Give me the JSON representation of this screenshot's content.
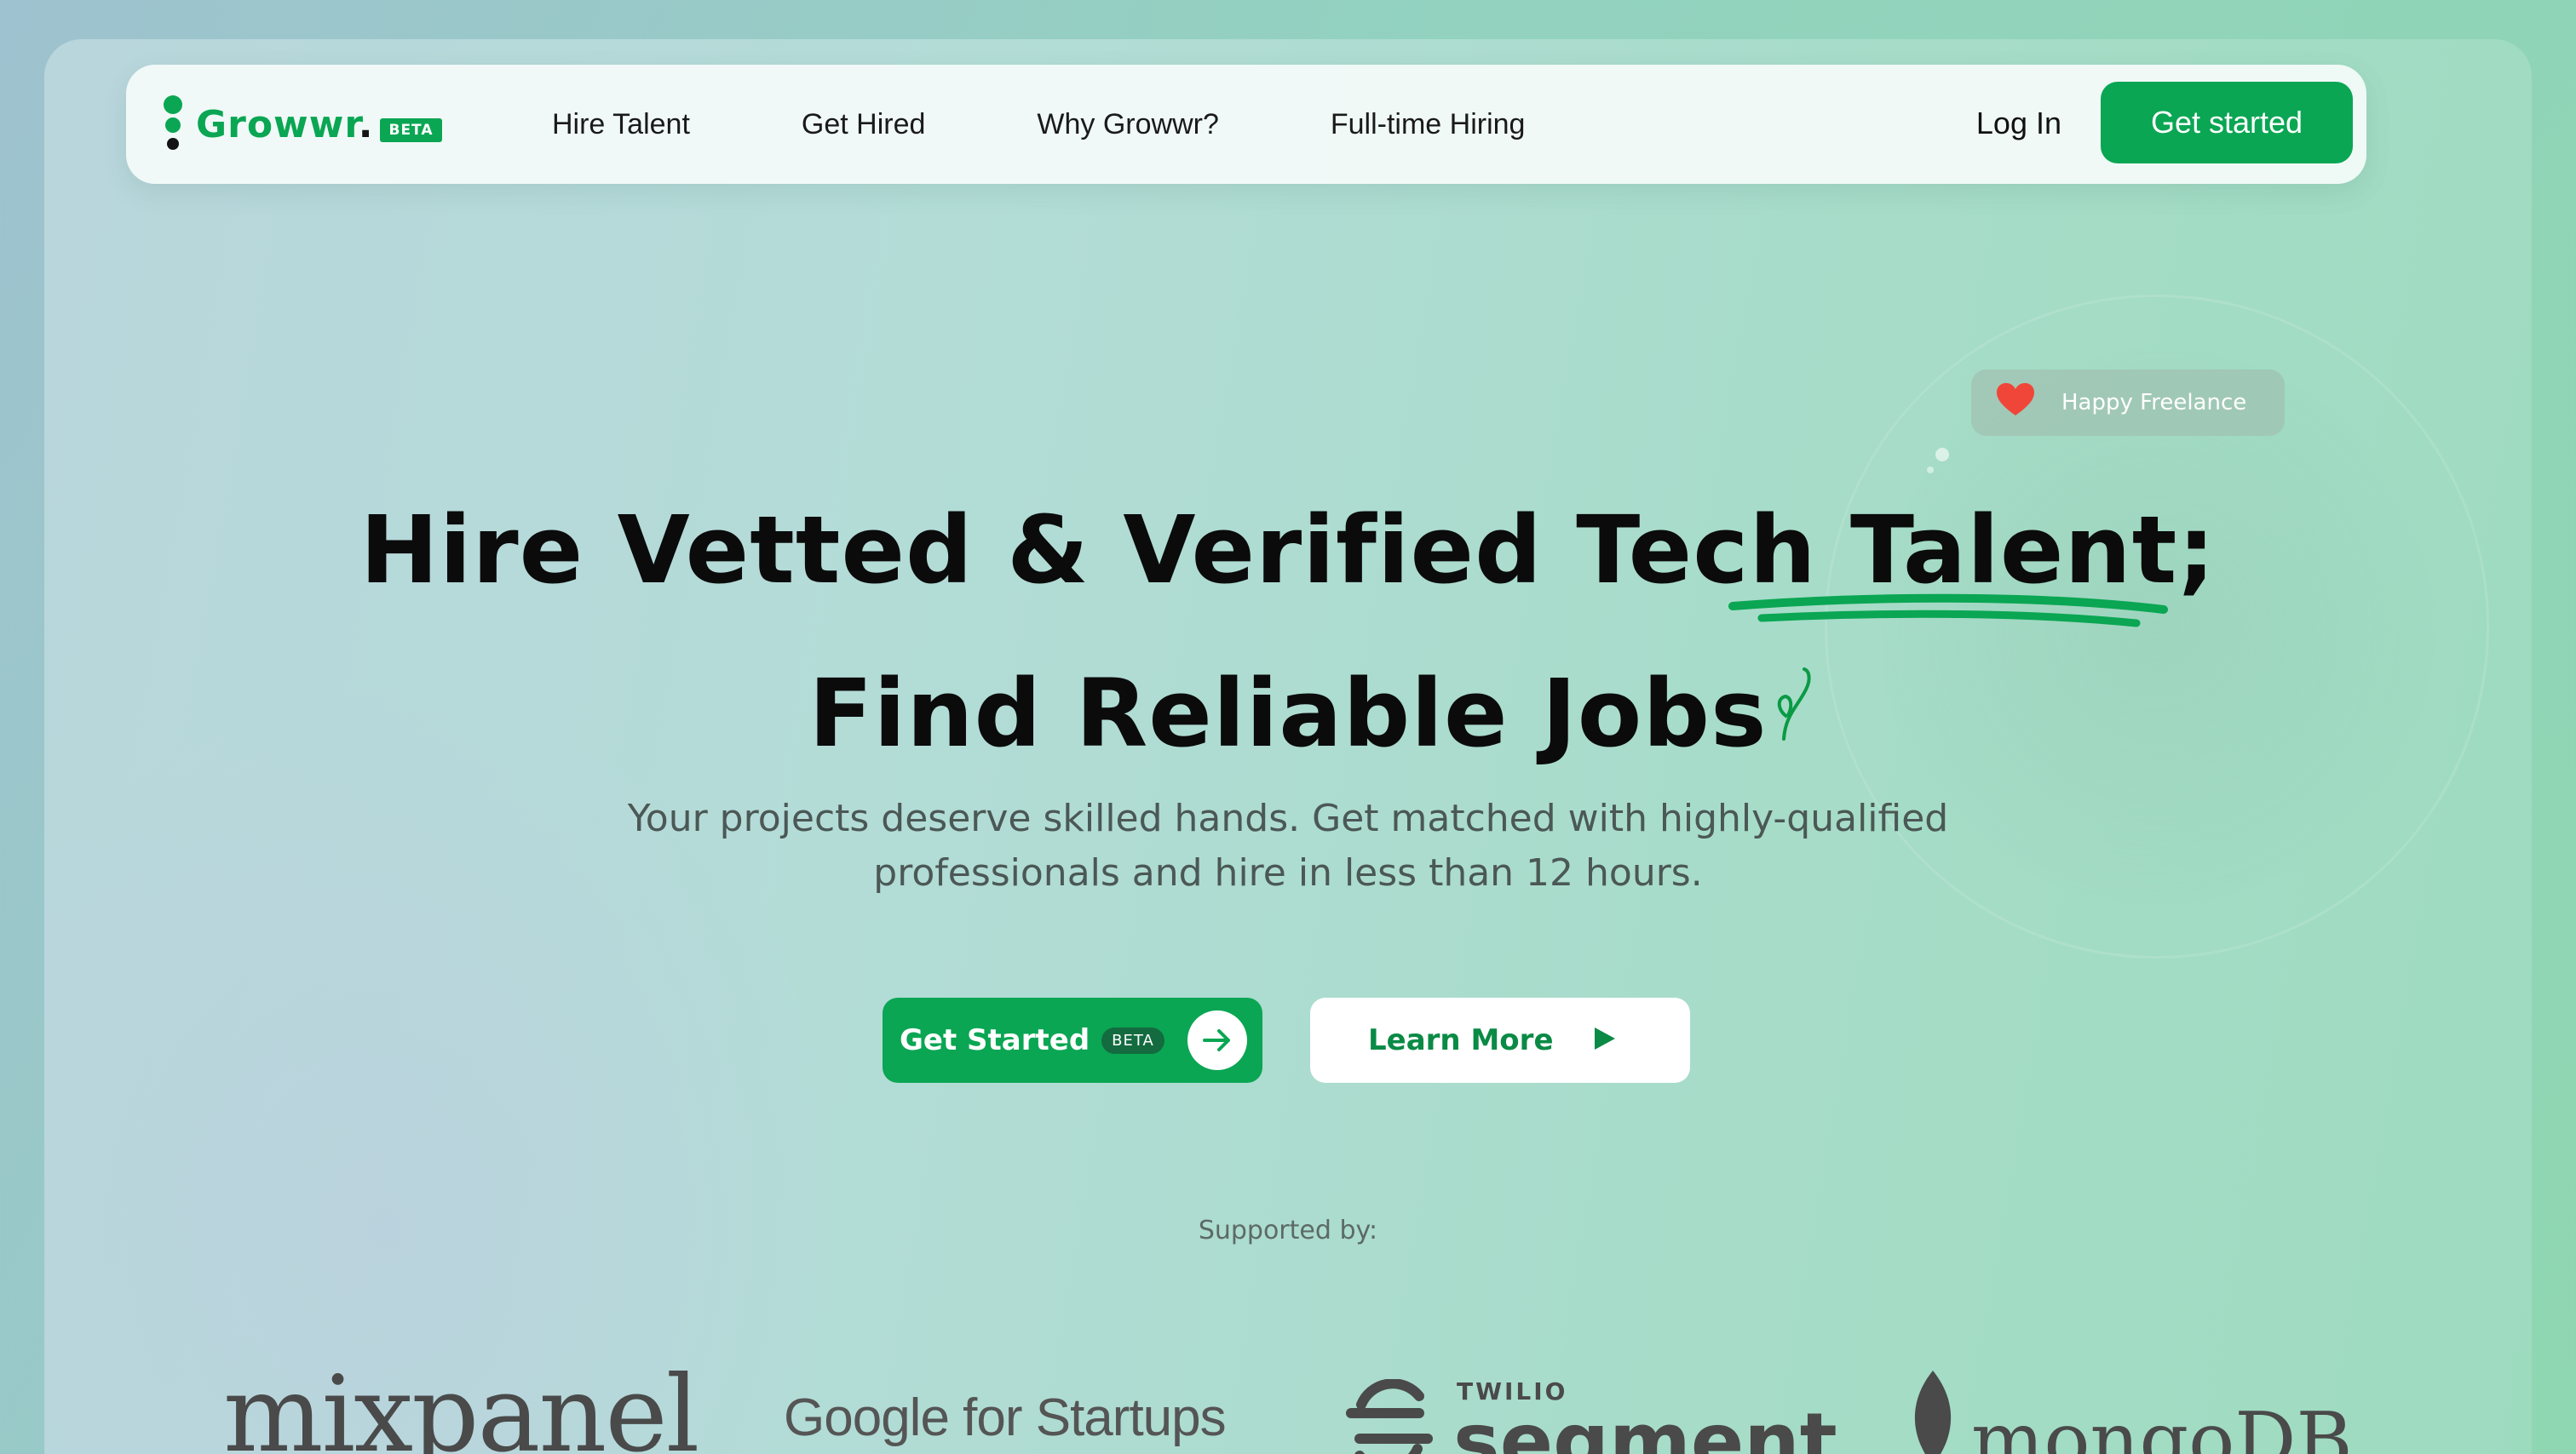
{
  "brand": {
    "name": "Growwr",
    "dot": ".",
    "beta": "BETA",
    "color": "#0aa653"
  },
  "nav": {
    "links": [
      "Hire Talent",
      "Get Hired",
      "Why Growwr?",
      "Full-time Hiring"
    ],
    "login": "Log In",
    "cta": "Get started"
  },
  "badge": {
    "icon": "heart-icon",
    "text": "Happy Freelance"
  },
  "hero": {
    "line1": "Hire Vetted & Verified Tech Talent;",
    "line2": "Find Reliable Jobs",
    "subtitle_line1": "Your projects deserve skilled hands. Get matched with highly-qualified",
    "subtitle_line2": "professionals and hire in less than 12 hours."
  },
  "buttons": {
    "primary": {
      "label": "Get Started",
      "tag": "BETA",
      "icon": "arrow-right-icon"
    },
    "secondary": {
      "label": "Learn More",
      "icon": "play-icon"
    }
  },
  "supporters": {
    "heading": "Supported by:",
    "logos": [
      {
        "name": "mixpanel"
      },
      {
        "name": "Google for Startups"
      },
      {
        "name": "segment",
        "prefix": "TWILIO"
      },
      {
        "name": "mongoDB"
      }
    ]
  },
  "colors": {
    "accent": "#0aa653",
    "heart": "#f0463a",
    "text": "#0b0b0b"
  }
}
